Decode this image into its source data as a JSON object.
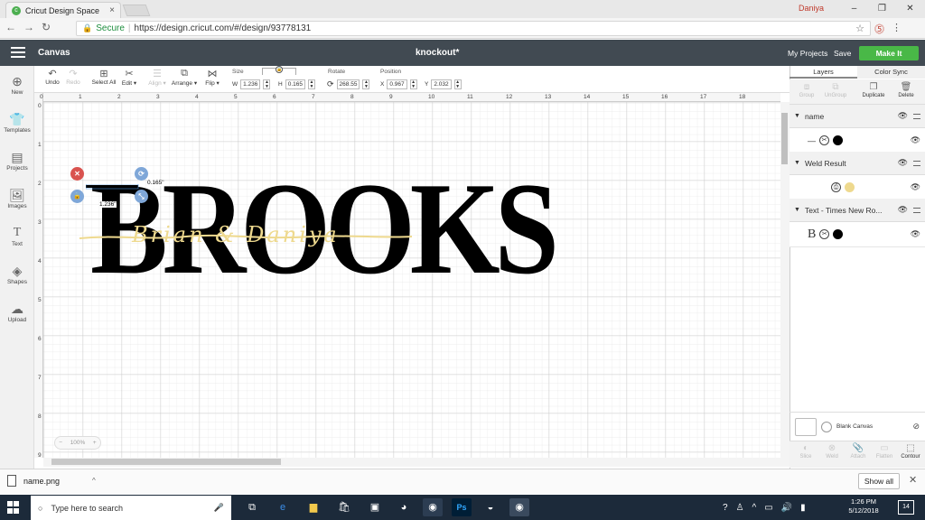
{
  "browser": {
    "tab_title": "Cricut Design Space",
    "tab_close": "×",
    "user": "Daniya",
    "window_controls": [
      "–",
      "❐",
      "✕"
    ],
    "nav": [
      "←",
      "→",
      "↻"
    ],
    "secure_label": "Secure",
    "url": "https://design.cricut.com/#/design/93778131"
  },
  "header": {
    "section": "Canvas",
    "document_title": "knockout*",
    "my_projects": "My Projects",
    "save": "Save",
    "make_it": "Make It"
  },
  "toolbar": {
    "undo": "Undo",
    "redo": "Redo",
    "select_all": "Select All",
    "edit": "Edit ▾",
    "align": "Align ▾",
    "arrange": "Arrange ▾",
    "flip": "Flip ▾",
    "size_label": "Size",
    "w_label": "W",
    "w_value": "1.236",
    "h_label": "H",
    "h_value": "0.165",
    "rotate_label": "Rotate",
    "rotate_value": "268.55",
    "position_label": "Position",
    "x_label": "X",
    "x_value": "0.967",
    "y_label": "Y",
    "y_value": "2.032"
  },
  "sidebar": {
    "items": [
      {
        "label": "New",
        "icon": "plus-icon"
      },
      {
        "label": "Templates",
        "icon": "shirt-icon"
      },
      {
        "label": "Projects",
        "icon": "projects-icon"
      },
      {
        "label": "Images",
        "icon": "image-icon"
      },
      {
        "label": "Text",
        "icon": "text-icon"
      },
      {
        "label": "Shapes",
        "icon": "shapes-icon"
      },
      {
        "label": "Upload",
        "icon": "upload-icon"
      }
    ]
  },
  "canvas": {
    "h_ruler": [
      "0",
      "1",
      "2",
      "3",
      "4",
      "5",
      "6",
      "7",
      "8",
      "9",
      "10",
      "11",
      "12",
      "13",
      "14",
      "15",
      "16",
      "17",
      "18"
    ],
    "v_ruler": [
      "0",
      "1",
      "2",
      "3",
      "4",
      "5",
      "6",
      "7",
      "8",
      "9"
    ],
    "text_main": "BROOKS",
    "text_script": "Brian & Daniya",
    "dim_w": "1.236\"",
    "dim_h": "0.165\"",
    "zoom": "100%",
    "zoom_minus": "−",
    "zoom_plus": "+"
  },
  "panel": {
    "tab_layers": "Layers",
    "tab_color_sync": "Color Sync",
    "tools": [
      "Group",
      "UnGroup",
      "Duplicate",
      "Delete"
    ],
    "layers": [
      {
        "name": "name",
        "row_prefix": "—",
        "color": "#000000"
      },
      {
        "name": "Weld Result",
        "row_prefix": "",
        "color": "#eed98e"
      },
      {
        "name": "Text - Times New Ro...",
        "row_prefix": "B",
        "color": "#000000"
      }
    ],
    "blank_canvas": "Blank Canvas",
    "bottom_tools": [
      "Slice",
      "Weld",
      "Attach",
      "Flatten",
      "Contour"
    ]
  },
  "downloads": {
    "file": "name.png",
    "show_all": "Show all",
    "close": "✕"
  },
  "taskbar": {
    "search_placeholder": "Type here to search",
    "time": "1:26 PM",
    "date": "5/12/2018",
    "notifications": "14"
  }
}
